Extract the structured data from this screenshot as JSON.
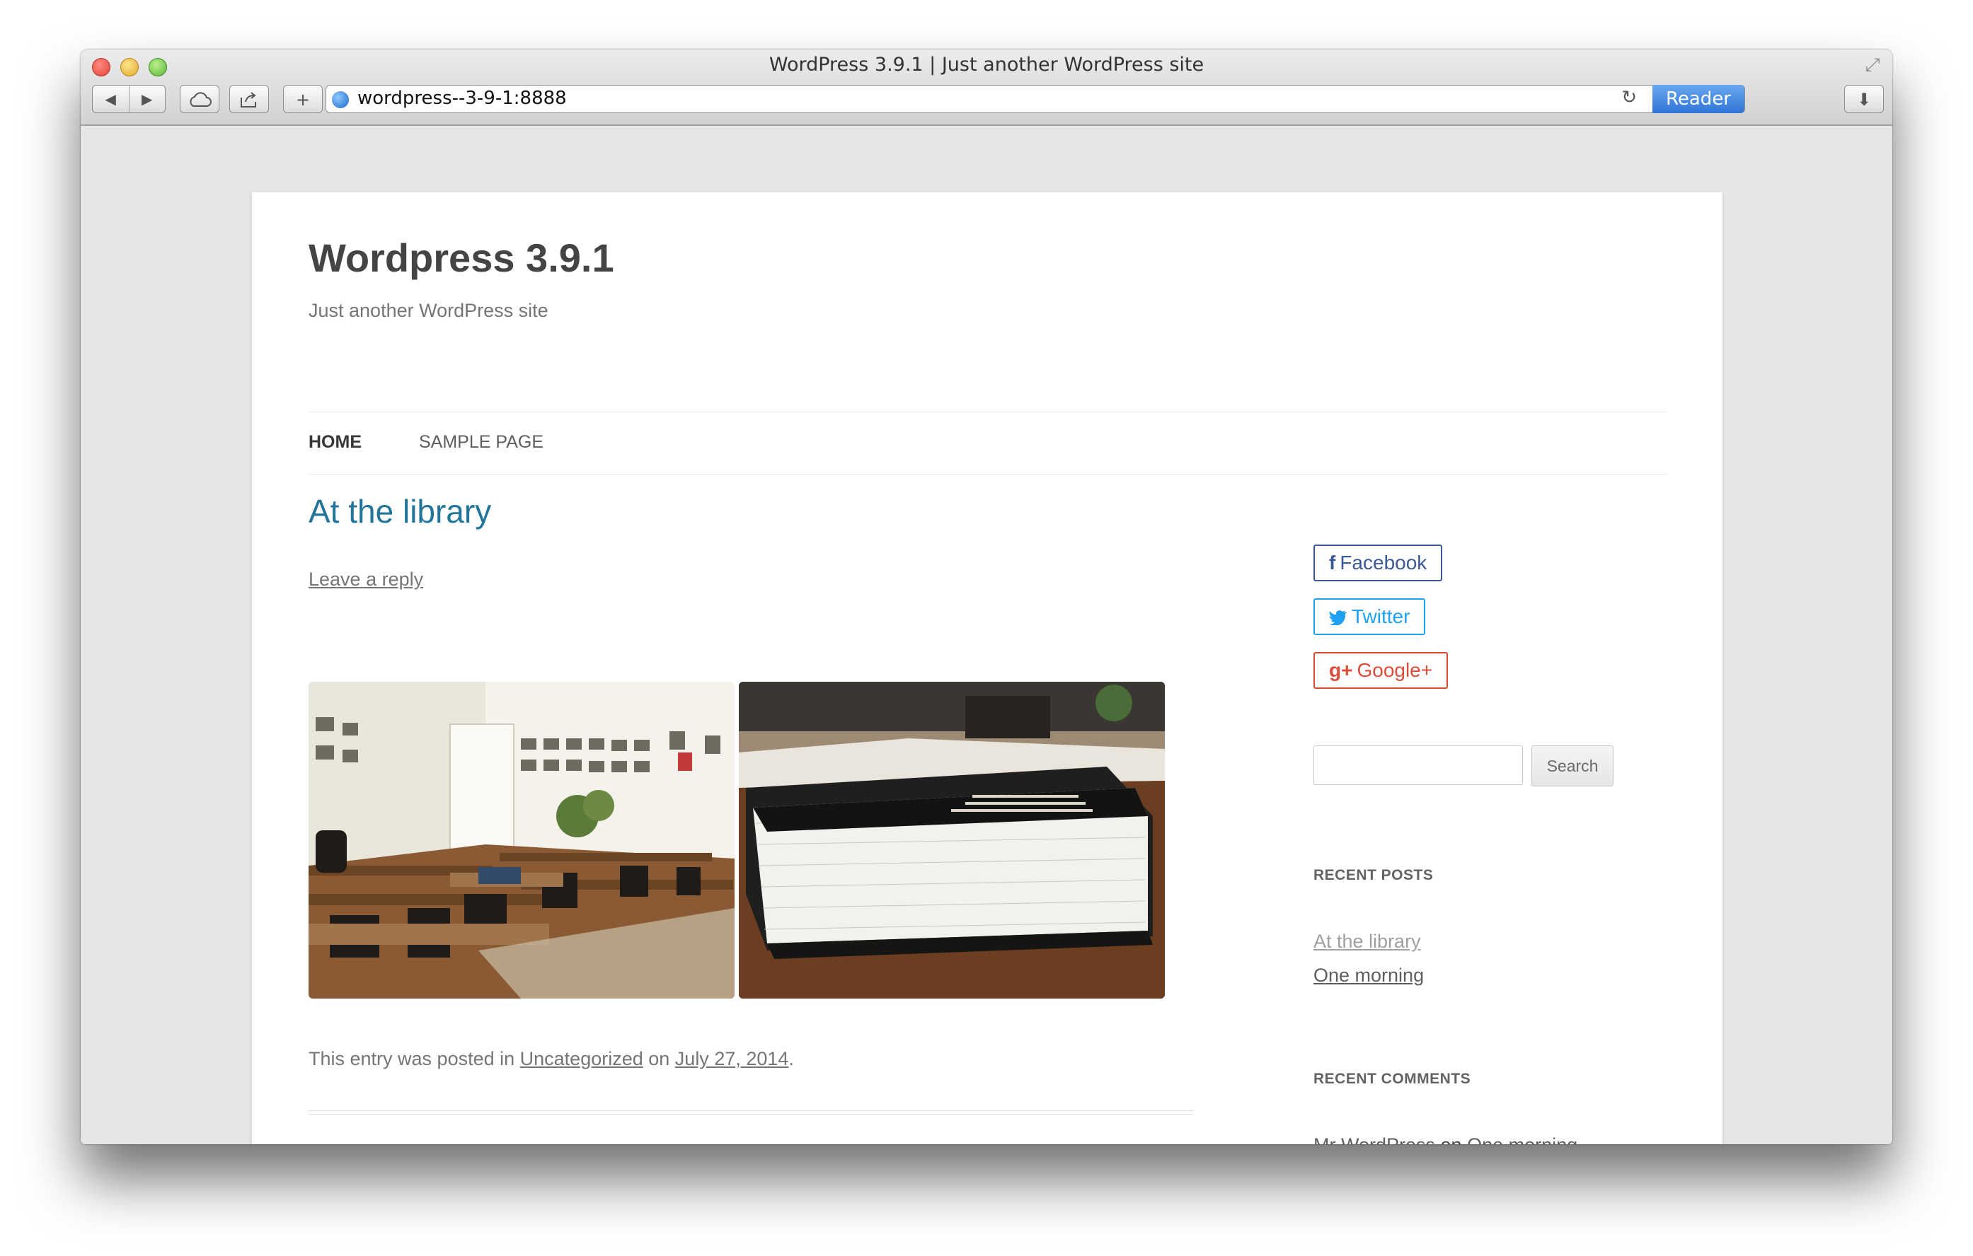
{
  "browser": {
    "window_title": "WordPress 3.9.1 | Just another WordPress site",
    "url": "wordpress--3-9-1:8888",
    "reader_label": "Reader",
    "back_icon": "◀",
    "forward_icon": "▶",
    "cloud_icon": "☁",
    "share_icon": "⇪",
    "newtab_icon": "+",
    "reload_icon": "↻",
    "download_icon": "⬇",
    "fullscreen_icon": "⤢"
  },
  "site": {
    "title": "Wordpress 3.9.1",
    "description": "Just another WordPress site"
  },
  "nav": {
    "items": [
      {
        "label": "HOME"
      },
      {
        "label": "SAMPLE PAGE"
      }
    ]
  },
  "post": {
    "title": "At the library",
    "leave_reply": "Leave a reply",
    "meta_prefix": "This entry was posted in ",
    "category": "Uncategorized",
    "meta_on": " on ",
    "date": "July 27, 2014",
    "meta_suffix": "."
  },
  "sidebar": {
    "social": {
      "facebook": "Facebook",
      "twitter": "Twitter",
      "google": "Google+",
      "facebook_icon": "f",
      "twitter_icon": "🐦",
      "google_icon": "g+"
    },
    "search": {
      "value": "",
      "button": "Search"
    },
    "recent_posts_title": "RECENT POSTS",
    "recent_posts": [
      "At the library",
      "One morning"
    ],
    "recent_comments_title": "RECENT COMMENTS",
    "recent_comment": {
      "author": "Mr WordPress",
      "on": " on ",
      "post": "One morning"
    }
  },
  "colors": {
    "link_blue": "#21759b",
    "facebook": "#3b5998",
    "twitter": "#1da1f2",
    "google": "#dd4b39",
    "reader_blue": "#2f75d6"
  }
}
